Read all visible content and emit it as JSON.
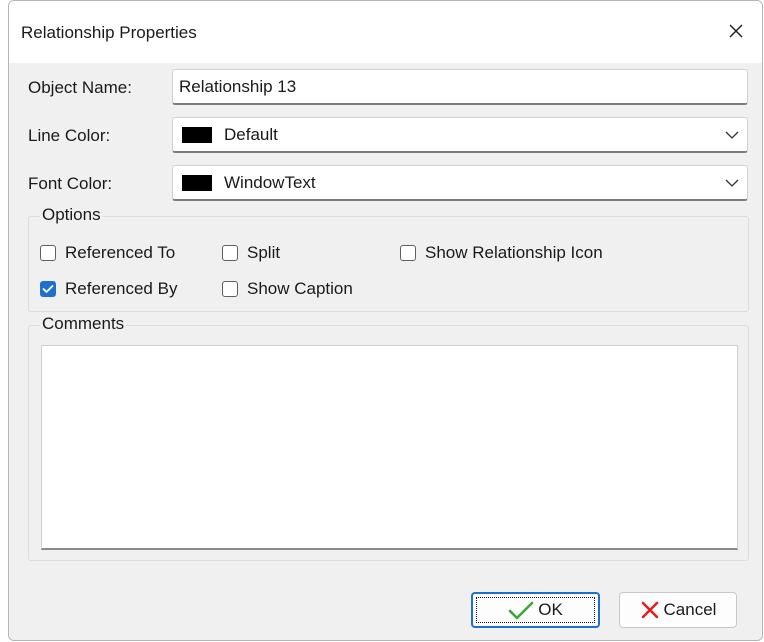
{
  "window": {
    "title": "Relationship Properties",
    "close_icon": "close-icon"
  },
  "form": {
    "object_name_label": "Object Name:",
    "object_name_value": "Relationship 13",
    "line_color_label": "Line Color:",
    "line_color_value": "Default",
    "line_color_swatch": "#000000",
    "font_color_label": "Font Color:",
    "font_color_value": "WindowText",
    "font_color_swatch": "#000000"
  },
  "options": {
    "title": "Options",
    "referenced_to": {
      "label": "Referenced To",
      "checked": false
    },
    "split": {
      "label": "Split",
      "checked": false
    },
    "show_relationship_icon": {
      "label": "Show Relationship Icon",
      "checked": false
    },
    "referenced_by": {
      "label": "Referenced By",
      "checked": true
    },
    "show_caption": {
      "label": "Show Caption",
      "checked": false
    }
  },
  "comments": {
    "title": "Comments",
    "value": ""
  },
  "buttons": {
    "ok_label": "OK",
    "ok_icon": "checkmark-icon",
    "cancel_label": "Cancel",
    "cancel_icon": "x-mark-icon"
  },
  "colors": {
    "accent": "#1f6fd1",
    "ok_check": "#3aa83a",
    "cancel_x": "#e02020"
  }
}
